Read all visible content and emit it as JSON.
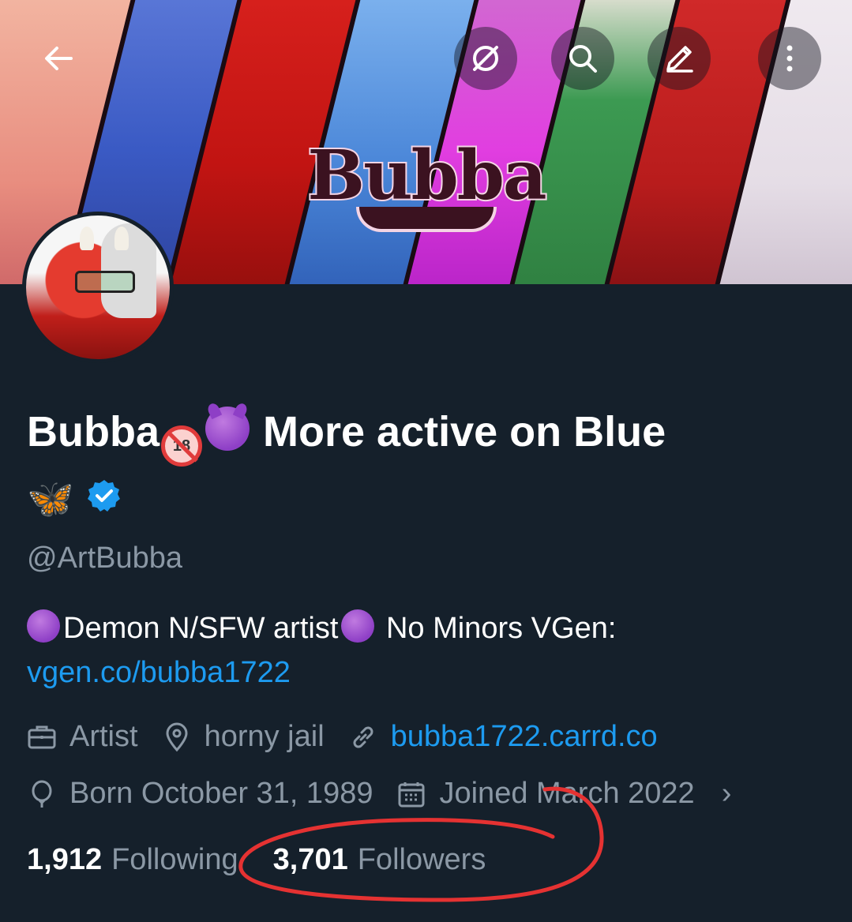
{
  "banner": {
    "logo_text": "Bubba"
  },
  "top_actions": {
    "back": "back-arrow",
    "hide": "eye-slash",
    "search": "search",
    "edit": "pencil",
    "more": "more-vertical"
  },
  "profile": {
    "display_name_prefix": "Bubba",
    "badge_18": "18",
    "display_name_suffix": "More active on Blue",
    "butterfly": "🦋",
    "handle": "@ArtBubba",
    "bio_text_1": "Demon N/SFW artist",
    "bio_text_2": "No Minors   VGen:",
    "bio_link": "vgen.co/bubba1722"
  },
  "meta": {
    "profession": "Artist",
    "location": "horny jail",
    "website": "bubba1722.carrd.co",
    "birthday": "Born October 31, 1989",
    "joined": "Joined March 2022",
    "chevron": "›"
  },
  "stats": {
    "following_count": "1,912",
    "following_label": "Following",
    "followers_count": "3,701",
    "followers_label": "Followers"
  },
  "colors": {
    "background": "#15202b",
    "secondary_text": "#8b98a5",
    "link": "#1d9bf0",
    "annotation": "#e53232"
  }
}
